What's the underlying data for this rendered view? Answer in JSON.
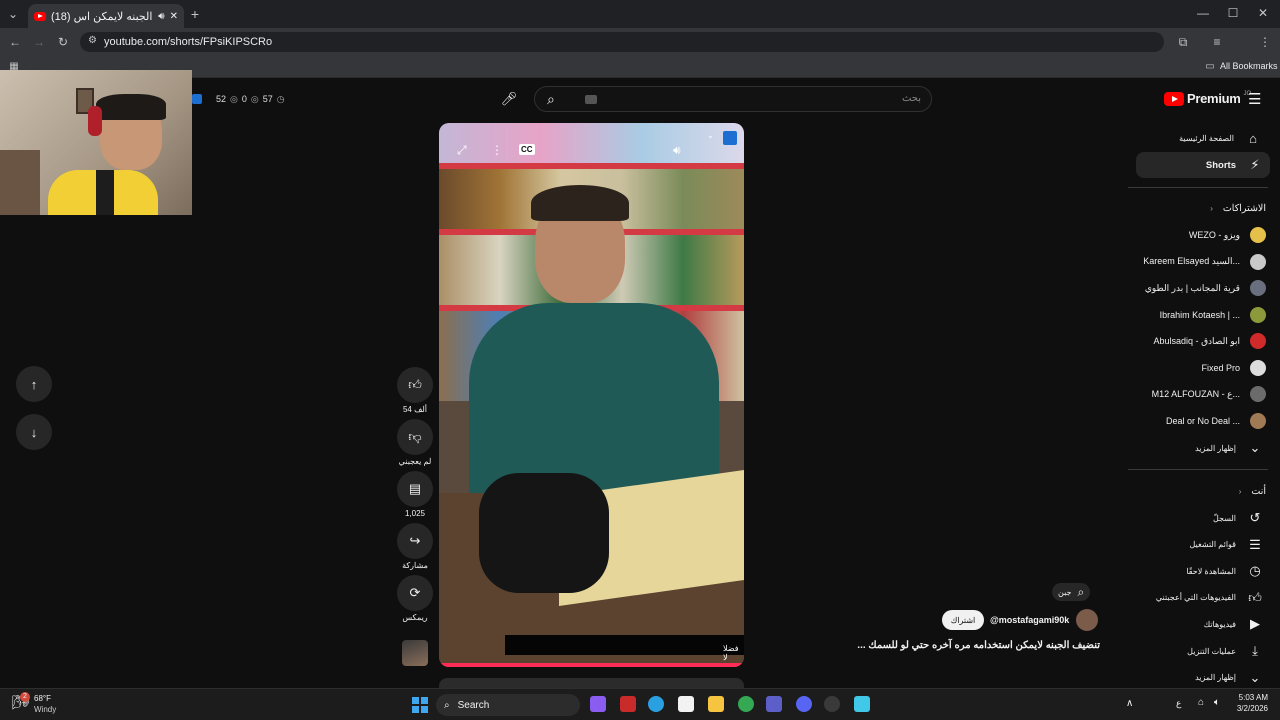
{
  "browser": {
    "tab_title": "(18) تنضيف الجبنه لايمكن اس",
    "new_tab": "+",
    "url": "youtube.com/shorts/FPsiKIPSCRo",
    "all_bookmarks": "All Bookmarks",
    "window_controls": [
      "—",
      "☐",
      "✕"
    ]
  },
  "overlay": {
    "stats": [
      "52",
      "0",
      "57"
    ]
  },
  "header": {
    "search_placeholder": "بحث",
    "search_value": "",
    "logo_text": "Premium",
    "logo_sup": "JO"
  },
  "actions": {
    "like_count": "54 ألف",
    "dislike_label": "لم يعجبني",
    "comments_count": "1,025",
    "share_label": "مشاركة",
    "remix_label": "ريمكس"
  },
  "video": {
    "cc_label": "CC",
    "caption": "فضلا لا",
    "search_chip": "جبن",
    "channel_handle": "@mostafagami90k",
    "subscribe": "اشتراك",
    "title": "تنضيف الجبنه لايمكن استخدامه مره آخره حتي لو للسمك ..."
  },
  "sidebar": {
    "home": "الصفحة الرئيسية",
    "shorts": "Shorts",
    "subscriptions_header": "الاشتراكات",
    "subscriptions": [
      {
        "name": "WEZO - ويزو",
        "color": "#e6c14a"
      },
      {
        "name": "Kareem Elsayed السيد...",
        "color": "#c9c9c9"
      },
      {
        "name": "قرية المجانب | بدر الطوي",
        "color": "#6a6f80"
      },
      {
        "name": "Ibrahim Kotaesh | ...",
        "color": "#8c9a3c"
      },
      {
        "name": "Abulsadiq - ابو الصادق",
        "color": "#d12a2a"
      },
      {
        "name": "Fixed Pro",
        "color": "#dddddd"
      },
      {
        "name": "M12 ALFOUZAN - ع...",
        "color": "#6b6b6b"
      },
      {
        "name": "Deal or No Deal ...",
        "color": "#a07a55"
      }
    ],
    "show_more_subs": "إظهار المزيد",
    "you_header": "أنت",
    "you_items": [
      {
        "label": "السجلّ",
        "icon": "history-icon"
      },
      {
        "label": "قوائم التشغيل",
        "icon": "playlists-icon"
      },
      {
        "label": "المشاهدة لاحقًا",
        "icon": "watch-later-icon"
      },
      {
        "label": "الفيديوهات التي أعجبتني",
        "icon": "liked-videos-icon"
      },
      {
        "label": "فيديوهاتك",
        "icon": "your-videos-icon"
      },
      {
        "label": "عمليات التنزيل",
        "icon": "downloads-icon"
      },
      {
        "label": "إظهار المزيد",
        "icon": "chevron-down-icon"
      }
    ]
  },
  "taskbar": {
    "temperature": "68°F",
    "weather": "Windy",
    "weather_badge": "2",
    "search_label": "Search",
    "time": "5:03 AM",
    "date": "3/2/2026",
    "lang": "ع"
  },
  "colors": {
    "accent": "#ff0000",
    "subscribe_bg": "#f1f1f1",
    "shelf": "#d43a43"
  }
}
